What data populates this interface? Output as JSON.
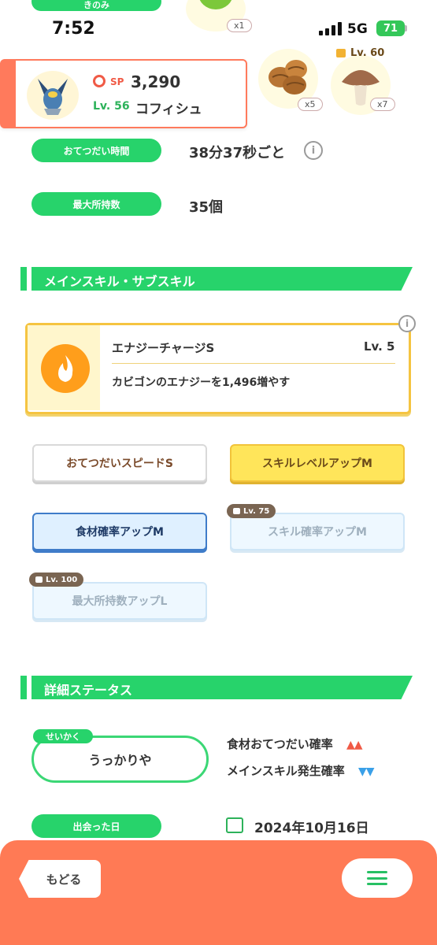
{
  "status_bar": {
    "time": "7:52",
    "network": "5G",
    "battery": "71"
  },
  "header_strip": {
    "top_pill": "きのみ",
    "items": [
      {
        "icon": "green-berry-icon",
        "qty": "x1"
      },
      {
        "icon": "walnut-icon",
        "qty": "x5"
      },
      {
        "icon": "mushroom-icon",
        "qty": "x7",
        "lock_level": "Lv. 60"
      }
    ]
  },
  "pokemon": {
    "sp_label": "SP",
    "sp_value": "3,290",
    "level": "Lv. 56",
    "name": "コフィシュ"
  },
  "rows": {
    "help_time_label": "おてつだい時間",
    "help_time_value": "38分37秒ごと",
    "max_carry_label": "最大所持数",
    "max_carry_value": "35個"
  },
  "skills_section": {
    "title": "メインスキル・サブスキル"
  },
  "main_skill": {
    "name": "エナジーチャージS",
    "level": "Lv. 5",
    "description": "カビゴンのエナジーを1,496増やす"
  },
  "sub_skills": [
    {
      "label": "おてつだいスピードS"
    },
    {
      "label": "スキルレベルアップM"
    },
    {
      "label": "食材確率アップM"
    },
    {
      "label": "スキル確率アップM",
      "lock": "Lv. 75"
    },
    {
      "label": "最大所持数アップL",
      "lock": "Lv. 100"
    }
  ],
  "details_section": {
    "title": "詳細ステータス"
  },
  "nature": {
    "tag": "せいかく",
    "value": "うっかりや",
    "up_label": "食材おてつだい確率",
    "up_arrows": "▲▲",
    "down_label": "メインスキル発生確率",
    "down_arrows": "▼▼"
  },
  "met_date": {
    "label": "出会った日",
    "value": "2024年10月16日"
  },
  "bottom": {
    "back_label": "もどる"
  },
  "colors": {
    "accent_green": "#27d36b",
    "accent_orange": "#ff7a55",
    "up": "#f05a46",
    "down": "#3aa0e8"
  }
}
